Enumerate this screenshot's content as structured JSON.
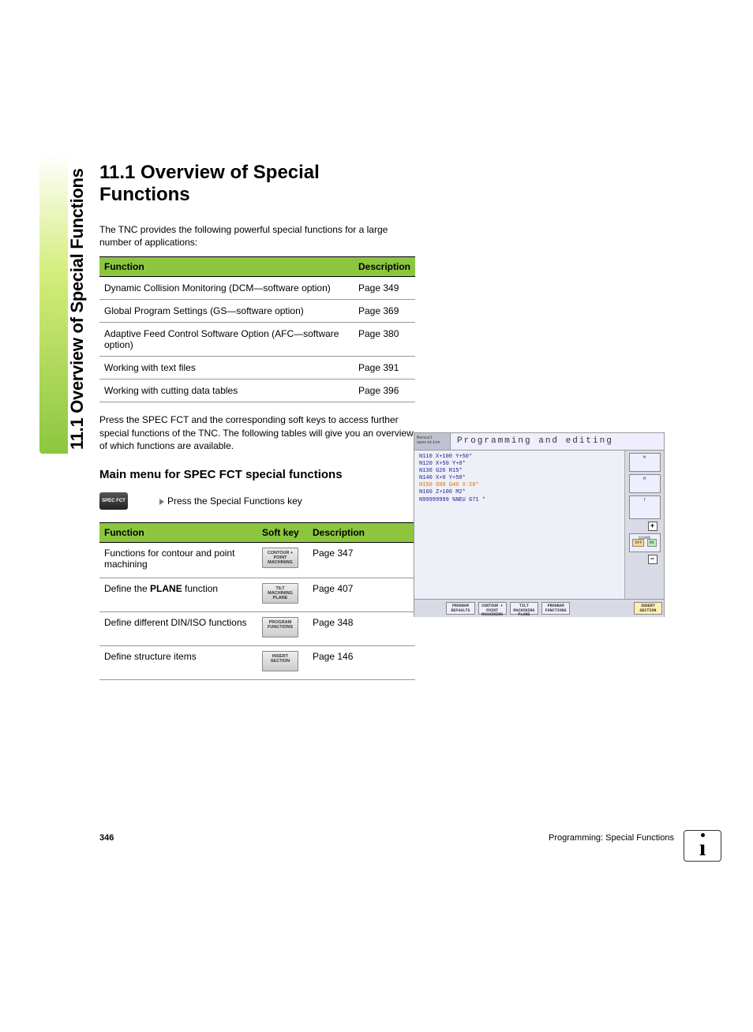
{
  "side_tab": "11.1 Overview of Special Functions",
  "heading": "11.1  Overview of Special Functions",
  "intro": "The TNC provides the following powerful special functions for a large number of applications:",
  "table1": {
    "headers": [
      "Function",
      "Description"
    ],
    "rows": [
      [
        "Dynamic Collision Monitoring (DCM—software option)",
        "Page 349"
      ],
      [
        "Global Program Settings (GS—software option)",
        "Page 369"
      ],
      [
        "Adaptive Feed Control Software Option (AFC—software option)",
        "Page 380"
      ],
      [
        "Working with text files",
        "Page 391"
      ],
      [
        "Working with cutting data tables",
        "Page 396"
      ]
    ]
  },
  "para2": "Press the SPEC FCT and the corresponding soft keys to access further special functions of the TNC. The following tables will give you an overview of which functions are available.",
  "subheading": "Main menu for SPEC FCT special functions",
  "specfct_key": "SPEC FCT",
  "press_text": "Press the Special Functions key",
  "table2": {
    "headers": [
      "Function",
      "Soft key",
      "Description"
    ],
    "rows": [
      {
        "func": "Functions for contour and point machining",
        "key": "CONTOUR + POINT MACHINING",
        "desc": "Page 347"
      },
      {
        "func_pre": "Define the ",
        "func_bold": "PLANE",
        "func_post": " function",
        "key": "TILT MACHINING PLANE",
        "desc": "Page 407"
      },
      {
        "func": "Define different DIN/ISO functions",
        "key": "PROGRAM FUNCTIONS",
        "desc": "Page 348"
      },
      {
        "func": "Define structure items",
        "key": "INSERT SECTION",
        "desc": "Page 146"
      }
    ]
  },
  "screenshot": {
    "mode": "Manual operation",
    "title": "Programming and editing",
    "code_lines": [
      "N110 X+100 Y+50*",
      "N120 X+50 Y+0*",
      "N130 G26 R15*",
      "N140 X+0 Y+50*",
      "N150 G00 G40 X-20*",
      "N160 Z+100 M2*",
      "N99999999 %NEU G71 *"
    ],
    "side_labels": {
      "m1": "M",
      "m2": "M",
      "t": "T",
      "s": "S100%",
      "off": "OFF",
      "on": "ON"
    },
    "softkeys": [
      "PROGRAM DEFAULTS",
      "CONTOUR + POINT MACHINING",
      "TILT MACHINING PLANE",
      "PROGRAM FUNCTIONS",
      "",
      "",
      "INSERT SECTION"
    ]
  },
  "footer": {
    "page": "346",
    "section": "Programming: Special Functions"
  }
}
